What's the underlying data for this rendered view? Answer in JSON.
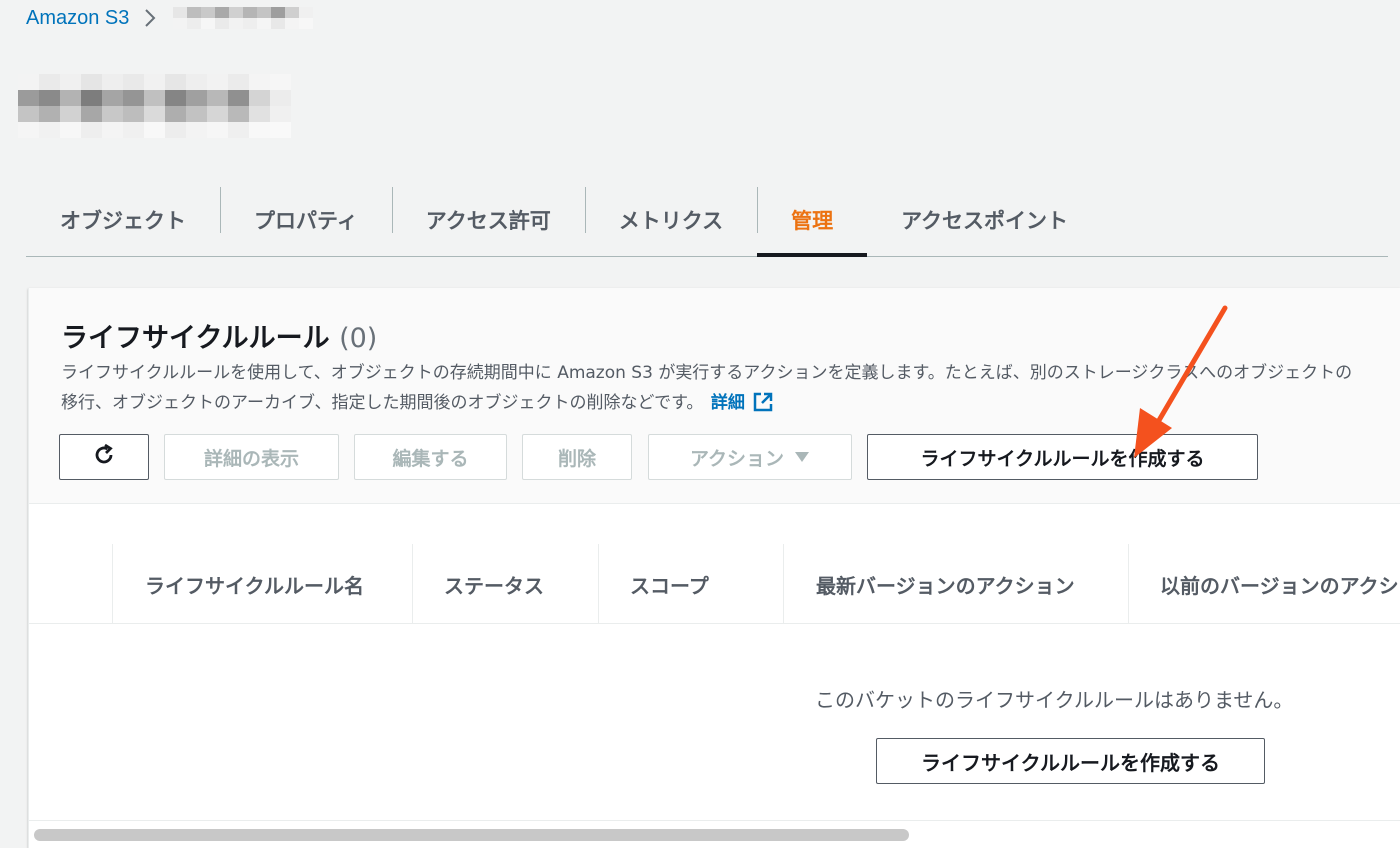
{
  "breadcrumb": {
    "root": "Amazon S3",
    "separator_icon": "chevron-right-icon"
  },
  "tabs": [
    {
      "label": "オブジェクト",
      "active": false
    },
    {
      "label": "プロパティ",
      "active": false
    },
    {
      "label": "アクセス許可",
      "active": false
    },
    {
      "label": "メトリクス",
      "active": false
    },
    {
      "label": "管理",
      "active": true
    },
    {
      "label": "アクセスポイント",
      "active": false
    }
  ],
  "lifecycle": {
    "title": "ライフサイクルルール",
    "count": "(0)",
    "description": "ライフサイクルルールを使用して、オブジェクトの存続期間中に Amazon S3 が実行するアクションを定義します。たとえば、別のストレージクラスへのオブジェクトの移行、オブジェクトのアーカイブ、指定した期間後のオブジェクトの削除などです。",
    "detail_link": "詳細",
    "detail_icon": "external-link-icon"
  },
  "toolbar": {
    "refresh_icon": "refresh-icon",
    "view_details": "詳細の表示",
    "edit": "編集する",
    "delete": "削除",
    "actions": "アクション",
    "actions_icon": "caret-down-icon",
    "create": "ライフサイクルルールを作成する"
  },
  "table": {
    "columns": [
      "ライフサイクルルール名",
      "ステータス",
      "スコープ",
      "最新バージョンのアクション",
      "以前のバージョンのアクション"
    ],
    "empty_message": "このバケットのライフサイクルルールはありません。",
    "empty_create": "ライフサイクルルールを作成する"
  },
  "colors": {
    "link": "#0073bb",
    "active_tab": "#ec7211",
    "annotation_arrow": "#f4511e"
  }
}
